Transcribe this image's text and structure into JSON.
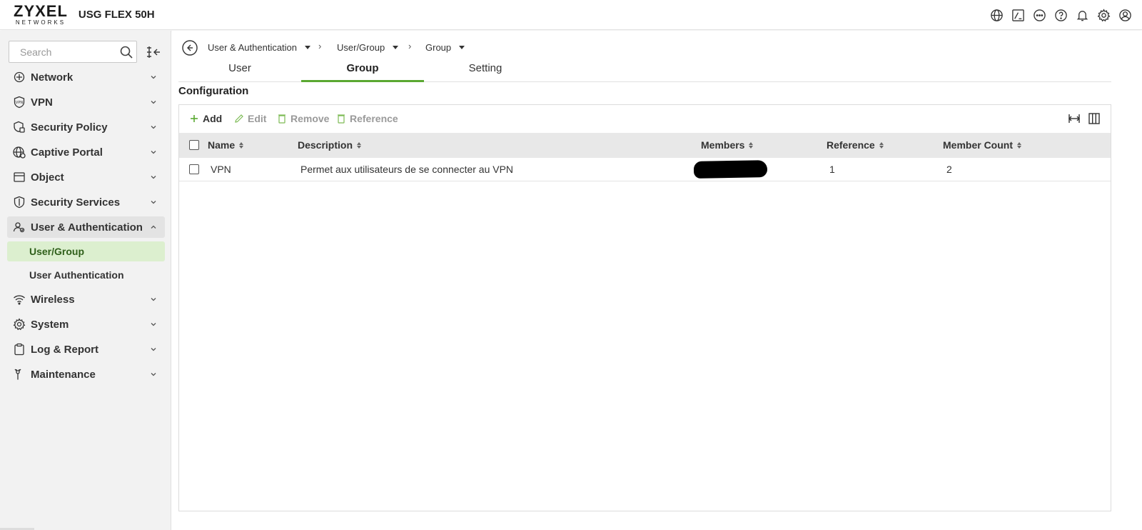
{
  "header": {
    "logo_main": "ZYXEL",
    "logo_sub": "NETWORKS",
    "device_name": "USG FLEX 50H",
    "icons": [
      "globe-icon",
      "terminal-icon",
      "more-icon",
      "help-icon",
      "bell-icon",
      "gear-icon",
      "user-icon"
    ]
  },
  "sidebar": {
    "search_placeholder": "Search",
    "items": [
      {
        "label": "Network",
        "icon": "network-icon"
      },
      {
        "label": "VPN",
        "icon": "vpn-shield-icon"
      },
      {
        "label": "Security Policy",
        "icon": "security-policy-icon"
      },
      {
        "label": "Captive Portal",
        "icon": "captive-portal-icon"
      },
      {
        "label": "Object",
        "icon": "object-icon"
      },
      {
        "label": "Security Services",
        "icon": "shield-icon"
      },
      {
        "label": "User & Authentication",
        "icon": "user-auth-icon"
      },
      {
        "label": "Wireless",
        "icon": "wifi-icon"
      },
      {
        "label": "System",
        "icon": "gear-icon"
      },
      {
        "label": "Log & Report",
        "icon": "clipboard-icon"
      },
      {
        "label": "Maintenance",
        "icon": "wrench-icon"
      }
    ],
    "subitems": [
      {
        "label": "User/Group"
      },
      {
        "label": "User Authentication"
      }
    ]
  },
  "breadcrumb": {
    "items": [
      "User & Authentication",
      "User/Group",
      "Group"
    ]
  },
  "tabs": [
    {
      "label": "User"
    },
    {
      "label": "Group"
    },
    {
      "label": "Setting"
    }
  ],
  "main": {
    "section_title": "Configuration"
  },
  "toolbar": {
    "add": "Add",
    "edit": "Edit",
    "remove": "Remove",
    "reference": "Reference"
  },
  "table": {
    "columns": [
      "Name",
      "Description",
      "Members",
      "Reference",
      "Member Count"
    ],
    "rows": [
      {
        "name": "VPN",
        "description": "Permet aux utilisateurs de se connecter au VPN",
        "members": "",
        "reference": "1",
        "member_count": "2"
      }
    ]
  },
  "colors": {
    "accent": "#5aa832",
    "selected_bg": "#dcefcf"
  }
}
